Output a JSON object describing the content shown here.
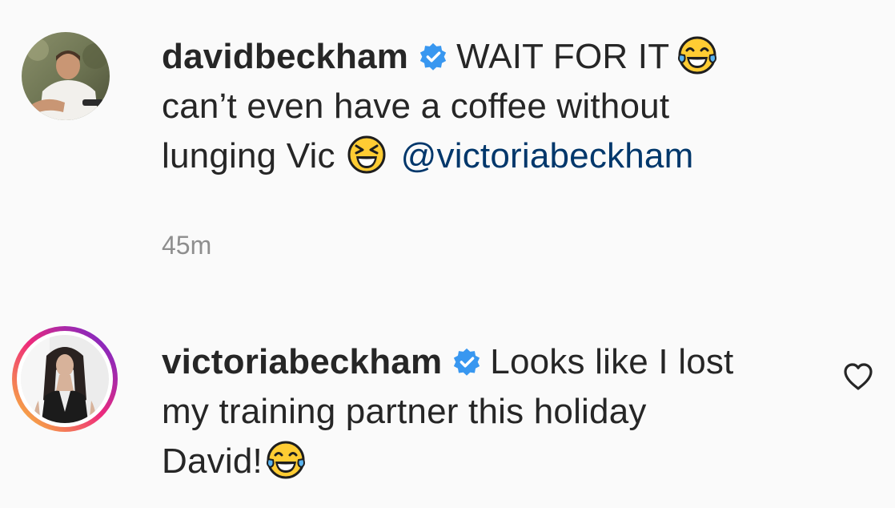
{
  "comments": [
    {
      "username": "davidbeckham",
      "verified": true,
      "text_line1": "WAIT FOR IT",
      "text_line2": "can’t even have a coffee without",
      "text_line3": "lunging Vic",
      "mention": "@victoriabeckham",
      "emojis": [
        "face-with-tears-of-joy-icon",
        "grinning-squinting-face-icon"
      ],
      "timestamp": "45m"
    },
    {
      "username": "victoriabeckham",
      "verified": true,
      "text_line1": "Looks like I lost",
      "text_line2": "my training partner this holiday",
      "text_line3": "David!",
      "emojis": [
        "face-with-tears-of-joy-icon"
      ],
      "has_story_ring": true
    }
  ],
  "colors": {
    "text": "#262626",
    "timestamp": "#8e8e8e",
    "mention": "#00376b",
    "verified": "#3897f0",
    "story_ring_start": "#f9ce34",
    "story_ring_mid": "#ee2a7b",
    "story_ring_end": "#6228d7"
  }
}
